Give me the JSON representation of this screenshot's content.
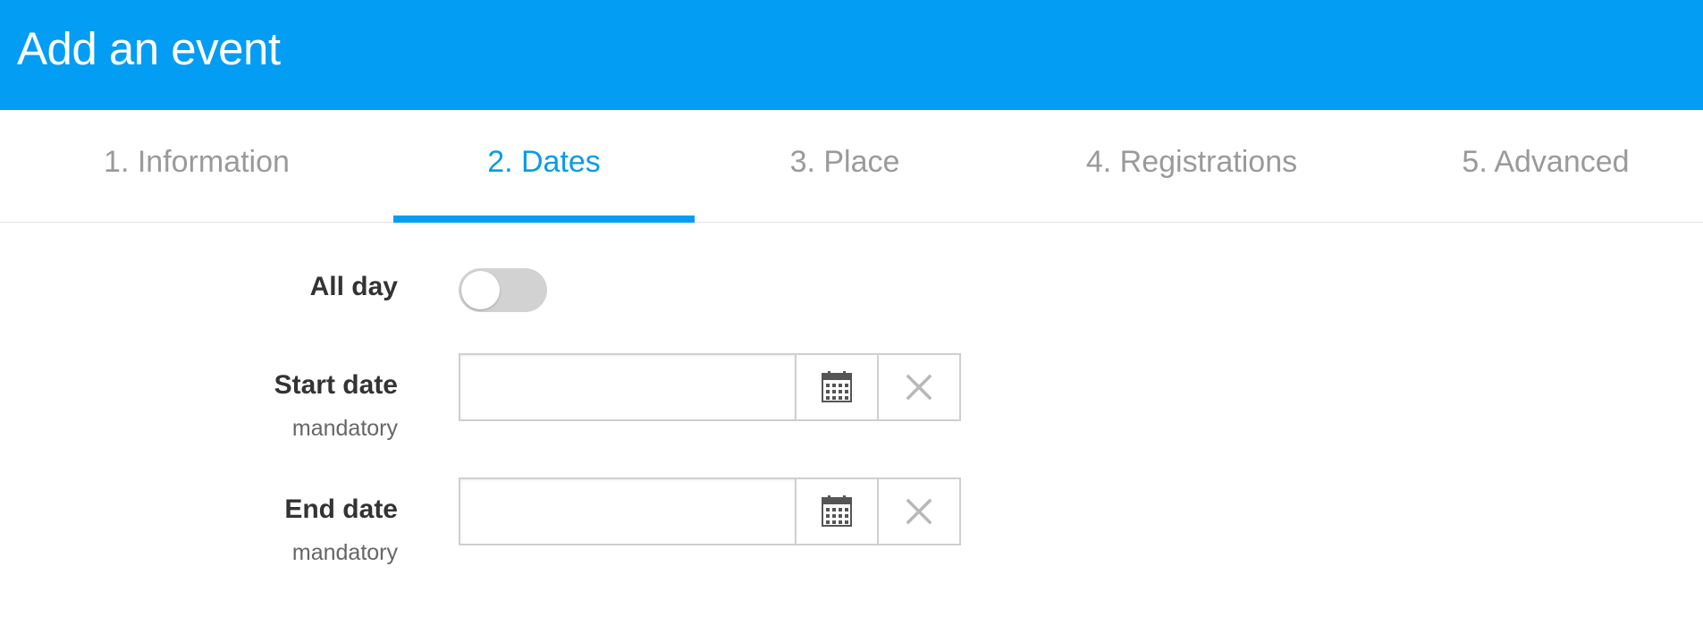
{
  "header": {
    "title": "Add an event"
  },
  "tabs": [
    {
      "label": "1. Information",
      "active": false
    },
    {
      "label": "2. Dates",
      "active": true
    },
    {
      "label": "3. Place",
      "active": false
    },
    {
      "label": "4. Registrations",
      "active": false
    },
    {
      "label": "5. Advanced",
      "active": false
    }
  ],
  "form": {
    "all_day": {
      "label": "All day",
      "value": false
    },
    "start_date": {
      "label": "Start date",
      "sublabel": "mandatory",
      "value": "",
      "calendar_icon": "calendar-icon",
      "clear_icon": "clear-icon"
    },
    "end_date": {
      "label": "End date",
      "sublabel": "mandatory",
      "value": "",
      "calendar_icon": "calendar-icon",
      "clear_icon": "clear-icon"
    }
  },
  "colors": {
    "header_bg": "#039df4",
    "active_tab": "#0a9be8",
    "inactive_tab": "#9a9a9a",
    "toggle_off": "#d2d2d2"
  }
}
